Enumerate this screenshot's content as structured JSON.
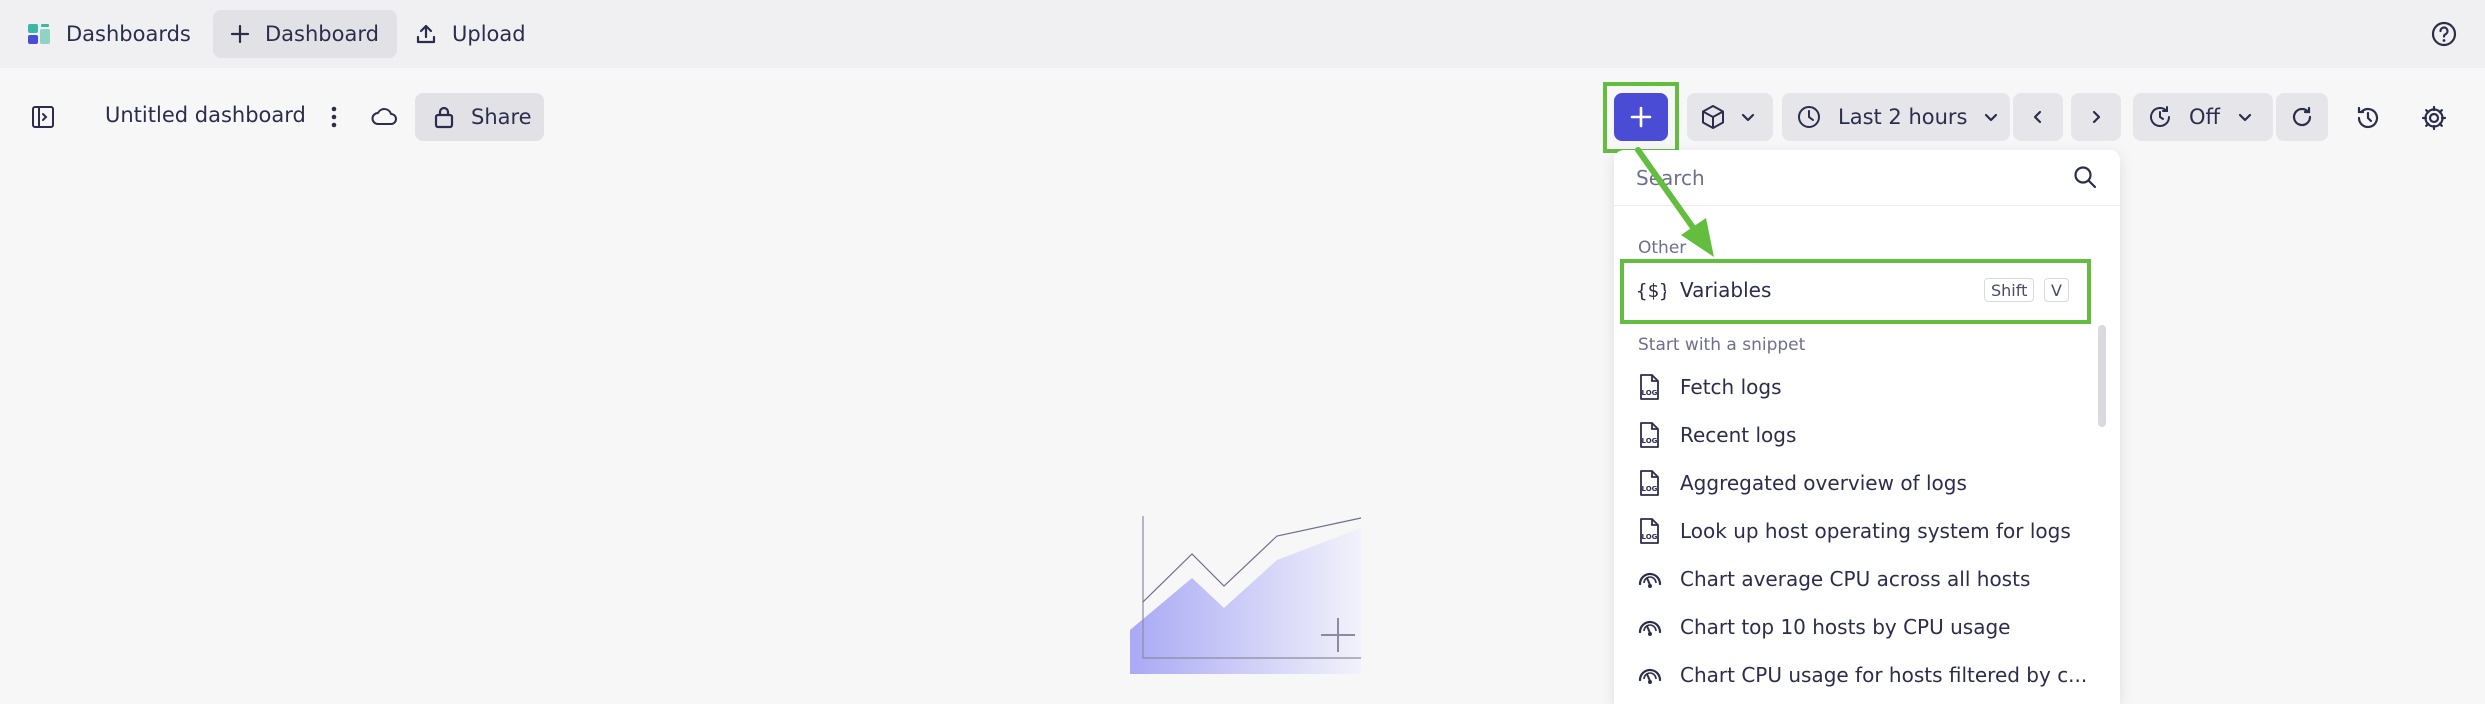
{
  "topbar": {
    "dashboards_label": "Dashboards",
    "new_dashboard_label": "Dashboard",
    "upload_label": "Upload"
  },
  "dashboard": {
    "title": "Untitled dashboard",
    "share_label": "Share",
    "timeframe": "Last 2 hours",
    "refresh_state": "Off"
  },
  "add_menu": {
    "search_placeholder": "Search",
    "sections": {
      "other": "Other",
      "snippets": "Start with a snippet"
    },
    "variables": {
      "label": "Variables",
      "shortcut": [
        "Shift",
        "V"
      ]
    },
    "snippets": [
      {
        "label": "Fetch logs",
        "icon": "log-file-icon"
      },
      {
        "label": "Recent logs",
        "icon": "log-file-icon"
      },
      {
        "label": "Aggregated overview of logs",
        "icon": "log-file-icon"
      },
      {
        "label": "Look up host operating system for logs",
        "icon": "log-file-icon"
      },
      {
        "label": "Chart average CPU across all hosts",
        "icon": "cpu-gauge-icon"
      },
      {
        "label": "Chart top 10 hosts by CPU usage",
        "icon": "cpu-gauge-icon"
      },
      {
        "label": "Chart CPU usage for hosts filtered by c...",
        "icon": "cpu-gauge-icon"
      }
    ]
  },
  "colors": {
    "accent": "#4b4cd6",
    "highlight": "#63be3f",
    "text": "#2c2d4d",
    "muted": "#6e6f8a"
  }
}
